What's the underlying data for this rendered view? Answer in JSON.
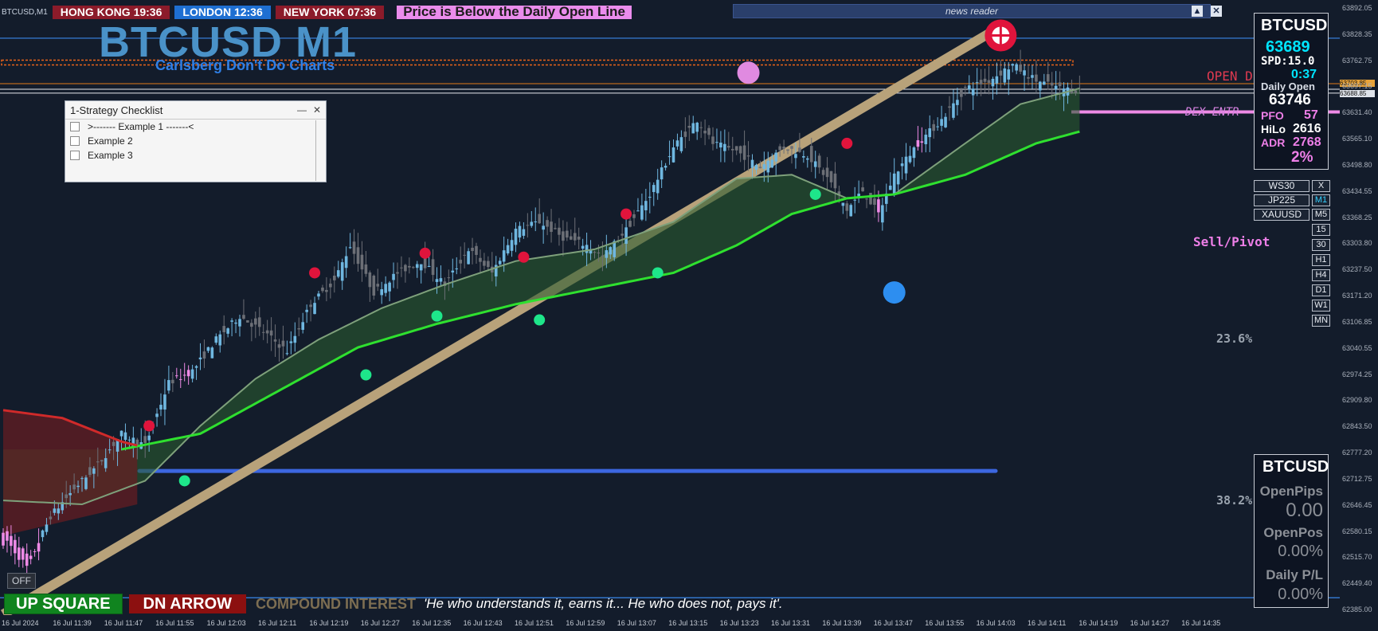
{
  "header": {
    "symbol_tag": "BTCUSD,M1",
    "clocks": [
      {
        "label": "HONG KONG 19:36"
      },
      {
        "label": "LONDON 12:36"
      },
      {
        "label": "NEW YORK 07:36"
      }
    ],
    "alert": "Price is Below the Daily Open Line",
    "news_label": "news reader"
  },
  "title": {
    "main": "BTCUSD M1",
    "sub": "Carlsberg Don't Do Charts"
  },
  "checklist": {
    "title": "1-Strategy Checklist",
    "min_glyph": "—",
    "close_glyph": "✕",
    "items": [
      ">------- Example 1 -------<",
      "Example 2",
      "Example 3"
    ]
  },
  "info_panel": {
    "symbol": "BTCUSD",
    "price": "63689",
    "spread_label": "SPD:15.0",
    "countdown": "0:37",
    "daily_open_label": "Daily Open",
    "daily_open_value": "63746",
    "pfo_label": "PFO",
    "pfo_value": "57",
    "hilo_label": "HiLo",
    "hilo_value": "2616",
    "adr_label": "ADR",
    "adr_value": "2768",
    "adr_pct": "2%"
  },
  "symbol_buttons": [
    "WS30",
    "JP225",
    "XAUUSD"
  ],
  "close_button": "X",
  "timeframes": [
    "M1",
    "M5",
    "15",
    "30",
    "H1",
    "H4",
    "D1",
    "W1",
    "MN"
  ],
  "active_timeframe": "M1",
  "pl_panel": {
    "symbol": "BTCUSD",
    "open_pips_label": "OpenPips",
    "open_pips_value": "0.00",
    "open_pos_label": "OpenPos",
    "open_pos_value": "0.00%",
    "daily_pl_label": "Daily P/L",
    "daily_pl_value": "0.00%"
  },
  "chart_labels": {
    "open_label": "OPEN D",
    "dex_label": "DEX ENTR",
    "sell_pivot": "Sell/Pivot",
    "fib_236": "23.6%",
    "fib_382": "38.2%"
  },
  "bottom": {
    "up_square": "UP SQUARE",
    "dn_arrow": "DN ARROW",
    "compound": "COMPOUND INTEREST",
    "quote": "'He who understands it, earns it... He who does not, pays it'.",
    "off_button": "OFF"
  },
  "price_tags": {
    "upper": "63703.85",
    "lower": "63688.85"
  },
  "colors": {
    "background": "#131c2b",
    "bull_candle": "#6fb7e0",
    "bear_candle": "#6c6f76",
    "pink_candle": "#ee8ae6",
    "ma_fast": "#7ea07b",
    "ma_slow": "#2fe02f",
    "ma_red": "#d02a2a",
    "trendline": "#b8a27a",
    "blue_line": "#3c66e0",
    "buy_dot": "#1ee68a",
    "sell_dot": "#e0143c"
  },
  "chart_data": {
    "type": "candlestick",
    "symbol": "BTCUSD",
    "timeframe": "M1",
    "y_ticks": [
      63892.05,
      63828.35,
      63762.75,
      63697.15,
      63631.4,
      63565.1,
      63498.8,
      63434.55,
      63368.25,
      63303.8,
      63237.5,
      63171.2,
      63106.85,
      63040.55,
      62974.25,
      62909.8,
      62843.5,
      62777.2,
      62712.75,
      62646.45,
      62580.15,
      62515.7,
      62449.4,
      62385.0
    ],
    "x_ticks": [
      "16 Jul 2024",
      "16 Jul 11:39",
      "16 Jul 11:47",
      "16 Jul 11:55",
      "16 Jul 12:03",
      "16 Jul 12:11",
      "16 Jul 12:19",
      "16 Jul 12:27",
      "16 Jul 12:35",
      "16 Jul 12:43",
      "16 Jul 12:51",
      "16 Jul 12:59",
      "16 Jul 13:07",
      "16 Jul 13:15",
      "16 Jul 13:23",
      "16 Jul 13:31",
      "16 Jul 13:39",
      "16 Jul 13:47",
      "16 Jul 13:55",
      "16 Jul 14:03",
      "16 Jul 14:11",
      "16 Jul 14:19",
      "16 Jul 14:27",
      "16 Jul 14:35"
    ],
    "ylim": [
      62370,
      63905
    ],
    "close_path": [
      [
        0,
        62560
      ],
      [
        6,
        62480
      ],
      [
        12,
        62610
      ],
      [
        18,
        62680
      ],
      [
        24,
        62740
      ],
      [
        30,
        62820
      ],
      [
        36,
        62790
      ],
      [
        42,
        62950
      ],
      [
        48,
        62980
      ],
      [
        54,
        63060
      ],
      [
        60,
        63120
      ],
      [
        66,
        63080
      ],
      [
        72,
        63030
      ],
      [
        78,
        63150
      ],
      [
        84,
        63210
      ],
      [
        88,
        63300
      ],
      [
        94,
        63180
      ],
      [
        100,
        63230
      ],
      [
        106,
        63260
      ],
      [
        112,
        63200
      ],
      [
        118,
        63290
      ],
      [
        124,
        63230
      ],
      [
        130,
        63340
      ],
      [
        136,
        63360
      ],
      [
        142,
        63320
      ],
      [
        148,
        63300
      ],
      [
        152,
        63270
      ],
      [
        158,
        63340
      ],
      [
        164,
        63430
      ],
      [
        170,
        63550
      ],
      [
        176,
        63620
      ],
      [
        180,
        63560
      ],
      [
        186,
        63540
      ],
      [
        192,
        63500
      ],
      [
        198,
        63550
      ],
      [
        204,
        63530
      ],
      [
        210,
        63460
      ],
      [
        214,
        63390
      ],
      [
        218,
        63440
      ],
      [
        222,
        63380
      ],
      [
        226,
        63480
      ],
      [
        232,
        63560
      ],
      [
        238,
        63620
      ],
      [
        244,
        63700
      ],
      [
        250,
        63720
      ],
      [
        256,
        63760
      ],
      [
        262,
        63720
      ],
      [
        268,
        63700
      ],
      [
        273,
        63695
      ]
    ],
    "ma_fast_path": [
      [
        0,
        62650
      ],
      [
        20,
        62640
      ],
      [
        36,
        62700
      ],
      [
        50,
        62840
      ],
      [
        64,
        62960
      ],
      [
        80,
        63060
      ],
      [
        96,
        63140
      ],
      [
        112,
        63200
      ],
      [
        130,
        63260
      ],
      [
        150,
        63290
      ],
      [
        170,
        63360
      ],
      [
        186,
        63470
      ],
      [
        200,
        63480
      ],
      [
        214,
        63420
      ],
      [
        226,
        63430
      ],
      [
        244,
        63560
      ],
      [
        258,
        63660
      ],
      [
        273,
        63700
      ]
    ],
    "ma_slow_path": [
      [
        30,
        62780
      ],
      [
        50,
        62820
      ],
      [
        70,
        62930
      ],
      [
        90,
        63040
      ],
      [
        110,
        63100
      ],
      [
        130,
        63150
      ],
      [
        150,
        63190
      ],
      [
        170,
        63230
      ],
      [
        186,
        63300
      ],
      [
        200,
        63380
      ],
      [
        214,
        63420
      ],
      [
        226,
        63430
      ],
      [
        244,
        63480
      ],
      [
        262,
        63560
      ],
      [
        273,
        63590
      ]
    ],
    "trend_band": {
      "x_start": 0,
      "y_start": 62360,
      "x_end": 250,
      "y_end": 63840
    },
    "horizontal_lines": {
      "top_blue": 63828,
      "orange_dashed": 63766,
      "orange_solid": 63712,
      "white_double": [
        63698,
        63688
      ],
      "pink": 63640,
      "bottom_blue_bar": 62725,
      "bottom_line": 62402
    },
    "buy_markers": [
      [
        46,
        62700
      ],
      [
        92,
        62970
      ],
      [
        110,
        63120
      ],
      [
        136,
        63110
      ],
      [
        166,
        63230
      ],
      [
        206,
        63430
      ]
    ],
    "sell_markers": [
      [
        37,
        62840
      ],
      [
        79,
        63230
      ],
      [
        107,
        63280
      ],
      [
        132,
        63270
      ],
      [
        158,
        63380
      ],
      [
        214,
        63560
      ]
    ],
    "big_markers": [
      {
        "type": "sell",
        "x": 189,
        "y": 63740
      },
      {
        "type": "buy",
        "x": 226,
        "y": 63180
      },
      {
        "type": "target",
        "x": 253,
        "y": 63835
      }
    ]
  }
}
